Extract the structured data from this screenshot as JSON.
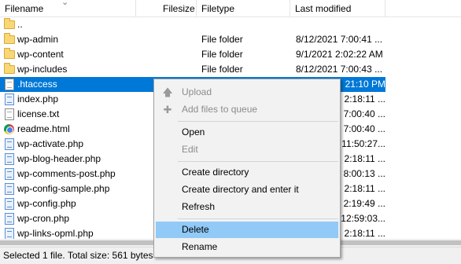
{
  "columns": {
    "filename": "Filename",
    "filesize": "Filesize",
    "filetype": "Filetype",
    "last_modified": "Last modified"
  },
  "files": [
    {
      "name": "..",
      "size": "",
      "type": "",
      "modified": "",
      "icon": "folder-icon"
    },
    {
      "name": "wp-admin",
      "size": "",
      "type": "File folder",
      "modified": "8/12/2021 7:00:41 ...",
      "icon": "folder-icon"
    },
    {
      "name": "wp-content",
      "size": "",
      "type": "File folder",
      "modified": "9/1/2021 2:02:22 AM",
      "icon": "folder-icon"
    },
    {
      "name": "wp-includes",
      "size": "",
      "type": "File folder",
      "modified": "8/12/2021 7:00:43 ...",
      "icon": "folder-icon"
    },
    {
      "name": ".htaccess",
      "size": "",
      "type": "",
      "modified": "21:10 PM",
      "icon": "file-icon",
      "selected": true
    },
    {
      "name": "index.php",
      "size": "",
      "type": "",
      "modified": "2:18:11 ...",
      "icon": "php-file-icon"
    },
    {
      "name": "license.txt",
      "size": "",
      "type": "",
      "modified": "7:00:40 ...",
      "icon": "text-file-icon"
    },
    {
      "name": "readme.html",
      "size": "",
      "type": "",
      "modified": "7:00:40 ...",
      "icon": "chrome-icon"
    },
    {
      "name": "wp-activate.php",
      "size": "",
      "type": "",
      "modified": "11:50:27...",
      "icon": "php-file-icon"
    },
    {
      "name": "wp-blog-header.php",
      "size": "",
      "type": "",
      "modified": "2:18:11 ...",
      "icon": "php-file-icon"
    },
    {
      "name": "wp-comments-post.php",
      "size": "",
      "type": "",
      "modified": "8:00:13 ...",
      "icon": "php-file-icon"
    },
    {
      "name": "wp-config-sample.php",
      "size": "",
      "type": "",
      "modified": "2:18:11 ...",
      "icon": "php-file-icon"
    },
    {
      "name": "wp-config.php",
      "size": "",
      "type": "",
      "modified": "2:19:49 ...",
      "icon": "php-file-icon"
    },
    {
      "name": "wp-cron.php",
      "size": "",
      "type": "",
      "modified": "12:59:03...",
      "icon": "php-file-icon"
    },
    {
      "name": "wp-links-opml.php",
      "size": "",
      "type": "",
      "modified": "2:18:11 ...",
      "icon": "php-file-icon"
    }
  ],
  "context_menu": {
    "upload": "Upload",
    "add_to_queue": "Add files to queue",
    "open": "Open",
    "edit": "Edit",
    "create_directory": "Create directory",
    "create_directory_enter": "Create directory and enter it",
    "refresh": "Refresh",
    "delete": "Delete",
    "rename": "Rename"
  },
  "status": {
    "text": "Selected 1 file. Total size: 561 bytes"
  },
  "colors": {
    "selection": "#0078d7",
    "menu_hover": "#91c9f7",
    "menu_bg": "#f2f2f2"
  }
}
